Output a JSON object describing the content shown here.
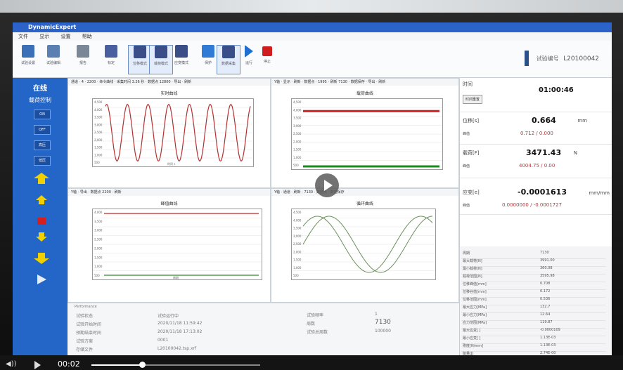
{
  "app": {
    "title": "DynamicExpert"
  },
  "menu": [
    "文件",
    "显示",
    "设置",
    "帮助"
  ],
  "toolbar": {
    "items": [
      {
        "label": "试验设置",
        "icon": "test-settings-icon"
      },
      {
        "label": "试验编辑",
        "icon": "test-edit-icon"
      },
      {
        "label": "报告",
        "icon": "report-icon"
      },
      {
        "label": "标定",
        "icon": "calibrate-icon"
      },
      {
        "label": "位移模式",
        "icon": "displacement-mode-icon"
      },
      {
        "label": "载荷模式",
        "icon": "load-mode-icon"
      },
      {
        "label": "应变模式",
        "icon": "strain-mode-icon"
      },
      {
        "label": "保护",
        "icon": "protect-icon"
      },
      {
        "label": "数据采集",
        "icon": "data-acquire-icon"
      },
      {
        "label": "运行",
        "icon": "run-icon"
      },
      {
        "label": "停止",
        "icon": "stop-icon"
      }
    ],
    "specimen_label": "试验编号",
    "specimen_id": "L20100042"
  },
  "left_panel": {
    "status": "在线",
    "control_mode": "载荷控制",
    "buttons": [
      "ON",
      "OFF",
      "高压",
      "低压"
    ]
  },
  "charts": {
    "chart1": {
      "title": "实时曲线",
      "header": "通道 · 4 · 2200 · 命令曲线 · 采集时间 3.26 秒 · 数据点 12800 · 导出 · 刷新"
    },
    "chart2": {
      "title": "载荷曲线",
      "header": "Y轴 · 显示 · 刷新 · 数据点 · 1995 · 刷新 7130 · 数据保存 · 导出 · 刷新"
    },
    "chart3": {
      "title": "峰值曲线",
      "header": "Y轴 · 导出 · 数据点 2200 · 刷新"
    },
    "chart4": {
      "title": "循环曲线",
      "header": "Y轴 · 通道 · 刷新 · 7130 · 数据点 · 数据保存"
    }
  },
  "chart_data": [
    {
      "type": "line",
      "title": "实时曲线",
      "ylim": [
        500,
        4500
      ],
      "yticks": [
        "4,500",
        "4,000",
        "3,500",
        "3,000",
        "2,500",
        "2,000",
        "1,500",
        "1,000",
        "500"
      ],
      "series": [
        {
          "color": "#b33030",
          "cycles": 7
        }
      ],
      "xlabel": "时间 s"
    },
    {
      "type": "line",
      "title": "载荷曲线",
      "ylim": [
        500,
        4500
      ],
      "yticks": [
        "4,500",
        "4,000",
        "3,500",
        "3,000",
        "2,500",
        "2,000",
        "1,500",
        "1,000",
        "500"
      ],
      "series": [
        {
          "color": "#cc2020",
          "level": 4000
        },
        {
          "color": "#1a8c1a",
          "level": 500
        }
      ]
    },
    {
      "type": "line",
      "title": "峰值曲线",
      "ylim": [
        500,
        4000
      ],
      "yticks": [
        "4,000",
        "3,500",
        "3,000",
        "2,500",
        "2,000",
        "1,500",
        "1,000",
        "500"
      ],
      "series": [
        {
          "color": "#cc2020",
          "level": 4000
        },
        {
          "color": "#2e8b2e",
          "level": 500
        }
      ],
      "xlabel": "周期"
    },
    {
      "type": "line",
      "title": "循环曲线",
      "ylim": [
        500,
        4500
      ],
      "yticks": [
        "4,500",
        "4,000",
        "3,500",
        "3,000",
        "2,500",
        "2,000",
        "1,500",
        "1,000",
        "500"
      ],
      "series": [
        {
          "color": "#6b8f5a"
        },
        {
          "color": "#6b8f5a"
        }
      ]
    }
  ],
  "bottom": {
    "title": "Performance",
    "rows": [
      {
        "k": "试验状态",
        "v": "试验运行中"
      },
      {
        "k": "试验开始时间",
        "v": "2020/11/18 11:59:42"
      },
      {
        "k": "预期结束时间",
        "v": "2020/11/18 17:13:02"
      },
      {
        "k": "试验方案",
        "v": "0001"
      },
      {
        "k": "存储文件",
        "v": "L20100042.tsp.xrf"
      }
    ],
    "right_rows": [
      {
        "k": "试验频率",
        "v": "1"
      },
      {
        "k": "周数",
        "v": "7130"
      },
      {
        "k": "试验总周数",
        "v": "100000"
      }
    ]
  },
  "right_panel": {
    "time_label": "时间",
    "time_value": "01:00:46",
    "time_button": "时间重置",
    "disp_label": "位移[s]",
    "disp_value": "0.664",
    "disp_unit": "mm",
    "disp_sub_label": "峰值",
    "disp_sub": "0.712 / 0.000",
    "load_label": "载荷[F]",
    "load_value": "3471.43",
    "load_unit": "N",
    "load_sub_label": "峰值",
    "load_sub": "4004.75 / 0.00",
    "strain_label": "应变[e]",
    "strain_value": "-0.0001613",
    "strain_unit": "mm/mm",
    "strain_sub_label": "峰值",
    "strain_sub": "0.0000000 / -0.0001727",
    "stats": [
      {
        "k": "周期",
        "v": "7130"
      },
      {
        "k": "最大载荷[N]",
        "v": "3991.00"
      },
      {
        "k": "最小载荷[N]",
        "v": "360.08"
      },
      {
        "k": "载荷范围[N]",
        "v": "3595.98"
      },
      {
        "k": "位移峰值[mm]",
        "v": "0.708"
      },
      {
        "k": "位移谷值[mm]",
        "v": "0.172"
      },
      {
        "k": "位移范围[mm]",
        "v": "0.536"
      },
      {
        "k": "最大应力[MPa]",
        "v": "132.7"
      },
      {
        "k": "最小应力[MPa]",
        "v": "12.64"
      },
      {
        "k": "应力范围[MPa]",
        "v": "119.87"
      },
      {
        "k": "最大应变[ ]",
        "v": "-0.0000109"
      },
      {
        "k": "最小应变[ ]",
        "v": "1.13E-03"
      },
      {
        "k": "刚度[N/mm]",
        "v": "1.13E-03"
      },
      {
        "k": "能量[J]",
        "v": "2.74E-00"
      }
    ]
  },
  "video": {
    "time": "00:02",
    "progress": 0.3
  }
}
